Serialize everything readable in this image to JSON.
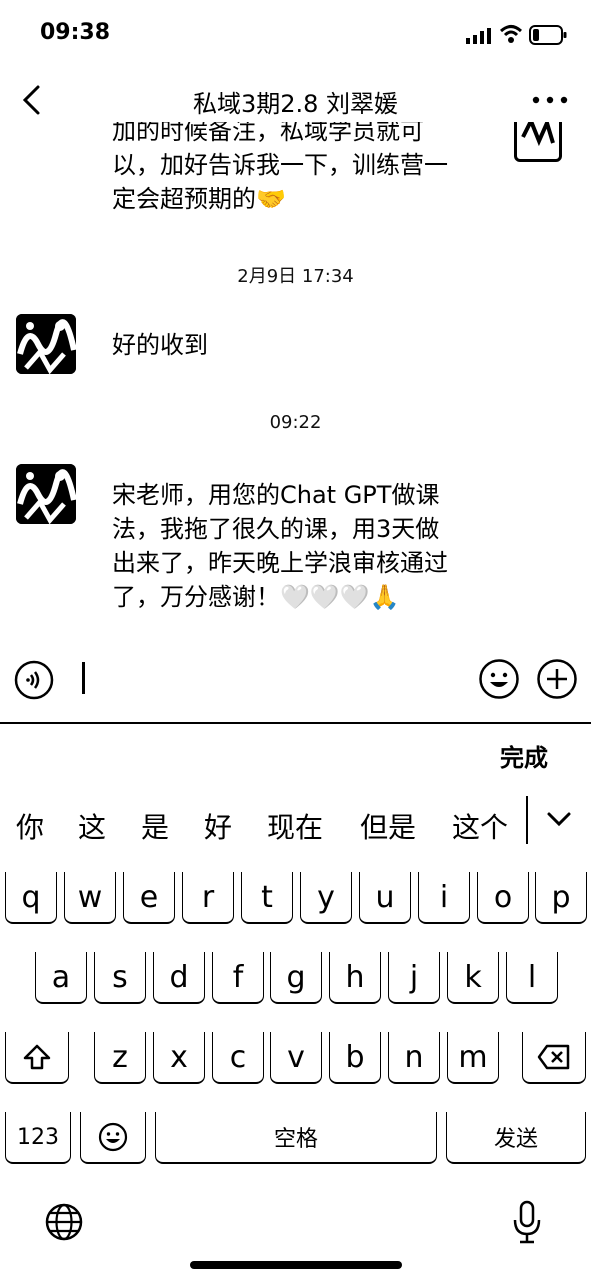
{
  "status_bar": {
    "time": "09:38"
  },
  "nav": {
    "title": "私域3期2.8 刘翠媛"
  },
  "messages": [
    {
      "side": "right",
      "lines": [
        "加的时候备注，私域学员就可",
        "以，加好告诉我一下，训练营一",
        "定会超预期的🤝"
      ]
    },
    {
      "side": "timestamp",
      "text": "2月9日 17:34"
    },
    {
      "side": "left",
      "lines": [
        "好的收到"
      ]
    },
    {
      "side": "timestamp",
      "text": "09:22"
    },
    {
      "side": "left",
      "lines": [
        "宋老师，用您的Chat GPT做课",
        "法，我拖了很久的课，用3天做",
        "出来了，昨天晚上学浪审核通过",
        "了，万分感谢！🤍🤍🤍🙏"
      ]
    }
  ],
  "keyboard": {
    "done_label": "完成",
    "candidates": [
      "你",
      "这",
      "是",
      "好",
      "现在",
      "但是",
      "这个"
    ],
    "row1": [
      "q",
      "w",
      "e",
      "r",
      "t",
      "y",
      "u",
      "i",
      "o",
      "p"
    ],
    "row2": [
      "a",
      "s",
      "d",
      "f",
      "g",
      "h",
      "j",
      "k",
      "l"
    ],
    "row3": [
      "z",
      "x",
      "c",
      "v",
      "b",
      "n",
      "m"
    ],
    "numbers_label": "123",
    "space_label": "空格",
    "send_label": "发送"
  }
}
